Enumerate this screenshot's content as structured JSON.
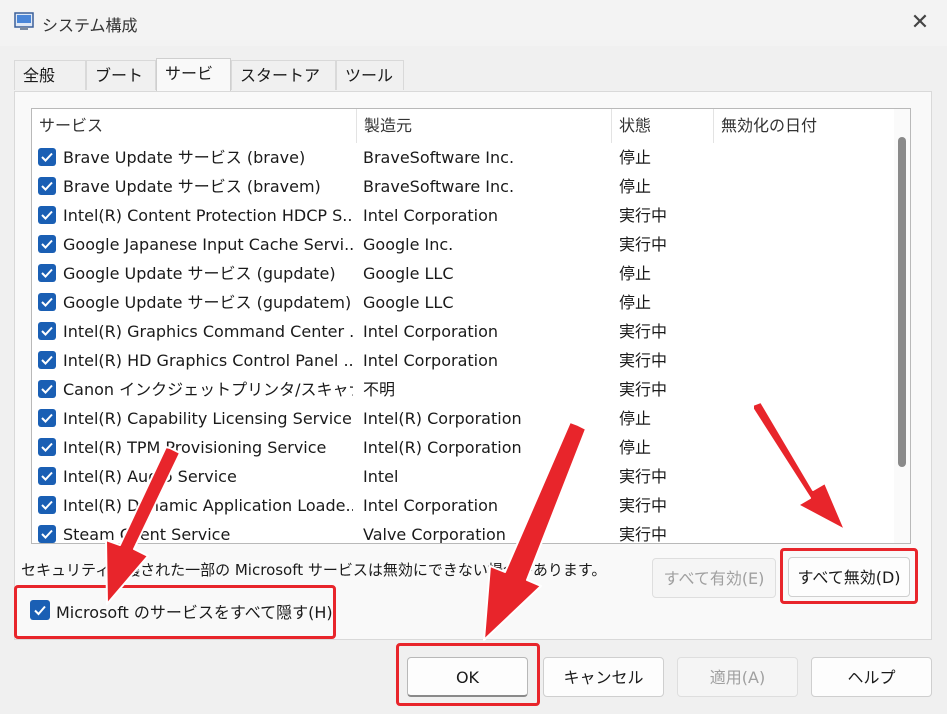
{
  "window": {
    "title": "システム構成"
  },
  "tabs": [
    {
      "label": "全般"
    },
    {
      "label": "ブート"
    },
    {
      "label": "サービス"
    },
    {
      "label": "スタートアップ"
    },
    {
      "label": "ツール"
    }
  ],
  "table": {
    "headers": [
      "サービス",
      "製造元",
      "状態",
      "無効化の日付"
    ],
    "rows": [
      {
        "name": "Brave Update サービス (brave)",
        "maker": "BraveSoftware Inc.",
        "status": "停止"
      },
      {
        "name": "Brave Update サービス (bravem)",
        "maker": "BraveSoftware Inc.",
        "status": "停止"
      },
      {
        "name": "Intel(R) Content Protection HDCP S...",
        "maker": "Intel Corporation",
        "status": "実行中"
      },
      {
        "name": "Google Japanese Input Cache Servi...",
        "maker": "Google Inc.",
        "status": "実行中"
      },
      {
        "name": "Google Update サービス (gupdate)",
        "maker": "Google LLC",
        "status": "停止"
      },
      {
        "name": "Google Update サービス (gupdatem)",
        "maker": "Google LLC",
        "status": "停止"
      },
      {
        "name": "Intel(R) Graphics Command Center ...",
        "maker": "Intel Corporation",
        "status": "実行中"
      },
      {
        "name": "Intel(R) HD Graphics Control Panel ...",
        "maker": "Intel Corporation",
        "status": "実行中"
      },
      {
        "name": "Canon インクジェットプリンタ/スキャナ/フ...",
        "maker": "不明",
        "status": "実行中"
      },
      {
        "name": "Intel(R) Capability Licensing Service ...",
        "maker": "Intel(R) Corporation",
        "status": "停止"
      },
      {
        "name": "Intel(R) TPM Provisioning Service",
        "maker": "Intel(R) Corporation",
        "status": "停止"
      },
      {
        "name": "Intel(R) Audio Service",
        "maker": "Intel",
        "status": "実行中"
      },
      {
        "name": "Intel(R) Dynamic Application Loade...",
        "maker": "Intel Corporation",
        "status": "実行中"
      },
      {
        "name": "Steam Client Service",
        "maker": "Valve Corporation",
        "status": "実行中"
      }
    ]
  },
  "note": "セキュリティ保護された一部の Microsoft サービスは無効にできない場合があります。",
  "buttons": {
    "enable_all": "すべて有効(E)",
    "disable_all": "すべて無効(D)",
    "ok": "OK",
    "cancel": "キャンセル",
    "apply": "適用(A)",
    "help": "ヘルプ"
  },
  "hide_ms": {
    "label": "Microsoft のサービスをすべて隠す(H)",
    "checked": true
  },
  "colors": {
    "accent": "#1a5fb4",
    "annotation": "#e8252b"
  }
}
